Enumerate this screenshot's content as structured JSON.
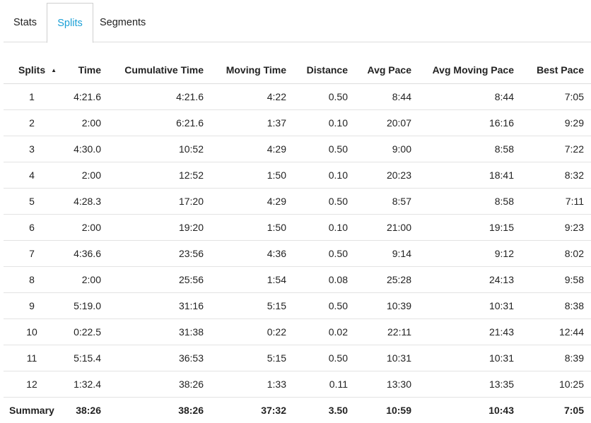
{
  "tabs": [
    {
      "label": "Stats",
      "active": false
    },
    {
      "label": "Splits",
      "active": true
    },
    {
      "label": "Segments",
      "active": false
    }
  ],
  "accent_color": "#1a9fd6",
  "table": {
    "sort_icon": "sort-ascending-icon",
    "columns": [
      "Splits",
      "Time",
      "Cumulative Time",
      "Moving Time",
      "Distance",
      "Avg Pace",
      "Avg Moving Pace",
      "Best Pace"
    ],
    "rows": [
      [
        "1",
        "4:21.6",
        "4:21.6",
        "4:22",
        "0.50",
        "8:44",
        "8:44",
        "7:05"
      ],
      [
        "2",
        "2:00",
        "6:21.6",
        "1:37",
        "0.10",
        "20:07",
        "16:16",
        "9:29"
      ],
      [
        "3",
        "4:30.0",
        "10:52",
        "4:29",
        "0.50",
        "9:00",
        "8:58",
        "7:22"
      ],
      [
        "4",
        "2:00",
        "12:52",
        "1:50",
        "0.10",
        "20:23",
        "18:41",
        "8:32"
      ],
      [
        "5",
        "4:28.3",
        "17:20",
        "4:29",
        "0.50",
        "8:57",
        "8:58",
        "7:11"
      ],
      [
        "6",
        "2:00",
        "19:20",
        "1:50",
        "0.10",
        "21:00",
        "19:15",
        "9:23"
      ],
      [
        "7",
        "4:36.6",
        "23:56",
        "4:36",
        "0.50",
        "9:14",
        "9:12",
        "8:02"
      ],
      [
        "8",
        "2:00",
        "25:56",
        "1:54",
        "0.08",
        "25:28",
        "24:13",
        "9:58"
      ],
      [
        "9",
        "5:19.0",
        "31:16",
        "5:15",
        "0.50",
        "10:39",
        "10:31",
        "8:38"
      ],
      [
        "10",
        "0:22.5",
        "31:38",
        "0:22",
        "0.02",
        "22:11",
        "21:43",
        "12:44"
      ],
      [
        "11",
        "5:15.4",
        "36:53",
        "5:15",
        "0.50",
        "10:31",
        "10:31",
        "8:39"
      ],
      [
        "12",
        "1:32.4",
        "38:26",
        "1:33",
        "0.11",
        "13:30",
        "13:35",
        "10:25"
      ]
    ],
    "summary": [
      "Summary",
      "38:26",
      "38:26",
      "37:32",
      "3.50",
      "10:59",
      "10:43",
      "7:05"
    ]
  }
}
